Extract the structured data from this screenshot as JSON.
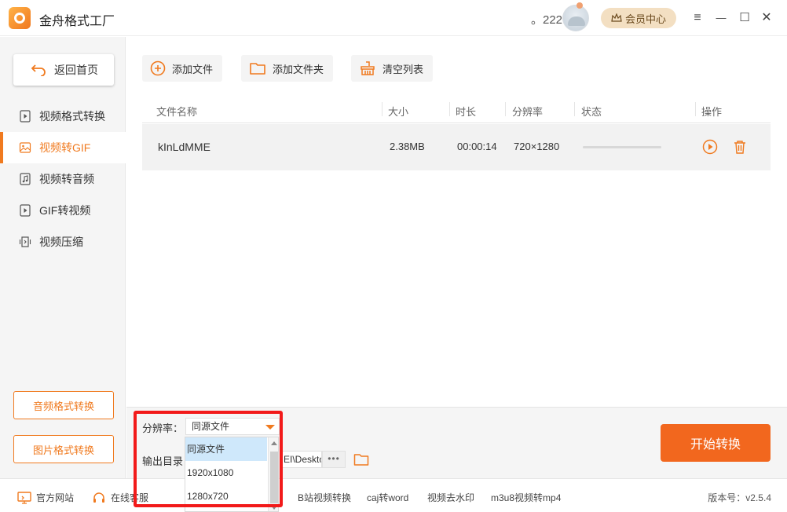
{
  "app": {
    "title": "金舟格式工厂",
    "coins": "。222",
    "vip_label": "会员中心"
  },
  "colors": {
    "accent": "#f07a1f",
    "start_button": "#f2671e",
    "highlight": "#f21a1a",
    "selected_option": "#cfe8fb"
  },
  "window_controls": {
    "menu": "≡",
    "minimize": "—",
    "maximize": "☐",
    "close": "✕"
  },
  "sidebar": {
    "back_label": "返回首页",
    "items": [
      {
        "label": "视频格式转换",
        "icon": "play-file-icon",
        "active": false
      },
      {
        "label": "视频转GIF",
        "icon": "image-file-icon",
        "active": true
      },
      {
        "label": "视频转音频",
        "icon": "music-file-icon",
        "active": false
      },
      {
        "label": "GIF转视频",
        "icon": "play-file-icon",
        "active": false
      },
      {
        "label": "视频压缩",
        "icon": "compress-icon",
        "active": false
      }
    ],
    "audio_convert_label": "音频格式转换",
    "image_convert_label": "图片格式转换"
  },
  "toolbar": {
    "add_file_label": "添加文件",
    "add_folder_label": "添加文件夹",
    "clear_list_label": "清空列表"
  },
  "table": {
    "columns": [
      "文件名称",
      "大小",
      "时长",
      "分辨率",
      "状态",
      "操作"
    ],
    "rows": [
      {
        "name": "kInLdMME",
        "size": "2.38MB",
        "duration": "00:00:14",
        "resolution": "720×1280",
        "progress": 0
      }
    ]
  },
  "settings": {
    "resolution_label": "分辨率：",
    "resolution_value": "同源文件",
    "resolution_options": [
      "同源文件",
      "1920x1080",
      "1280x720"
    ],
    "output_label": "输出目录",
    "output_path": "EI\\Deskto",
    "more_label": "•••",
    "start_label": "开始转换"
  },
  "statusbar": {
    "links": [
      "官方网站",
      "在线客服",
      "B站视频转换",
      "caj转word",
      "视频去水印",
      "m3u8视频转mp4"
    ],
    "version": "版本号：v2.5.4"
  }
}
